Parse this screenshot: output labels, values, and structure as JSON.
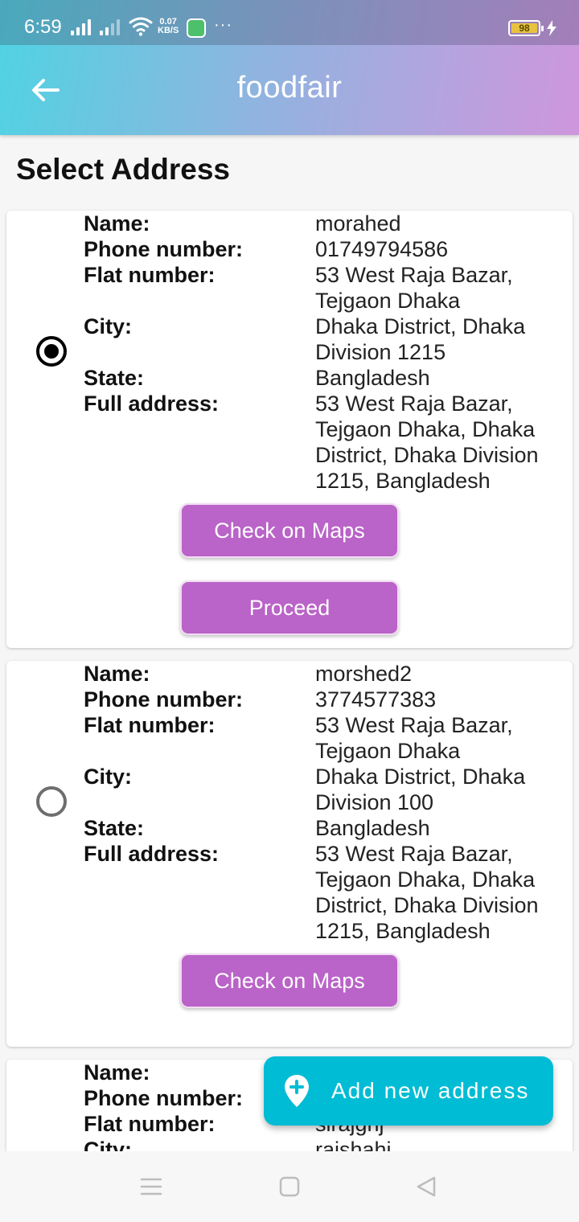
{
  "status_bar": {
    "time": "6:59",
    "net_speed_value": "0.07",
    "net_speed_unit": "KB/S",
    "more": "···",
    "battery": "98"
  },
  "app_bar": {
    "title": "foodfair",
    "back_icon": "arrow-left-icon"
  },
  "page": {
    "heading": "Select Address"
  },
  "labels": {
    "name": "Name:",
    "phone": "Phone number:",
    "flat": "Flat number:",
    "city": "City:",
    "state": "State:",
    "full": "Full address:"
  },
  "addresses": [
    {
      "selected": true,
      "name": "morahed",
      "phone": "01749794586",
      "flat": "53 West Raja Bazar, Tejgaon Dhaka",
      "city": "Dhaka District, Dhaka Division 1215",
      "state": "Bangladesh",
      "full": "53 West Raja Bazar, Tejgaon Dhaka, Dhaka District, Dhaka Division 1215, Bangladesh",
      "maps_label": "Check on Maps",
      "proceed_label": "Proceed"
    },
    {
      "selected": false,
      "name": "morshed2",
      "phone": "3774577383",
      "flat": "53 West Raja Bazar, Tejgaon Dhaka",
      "city": "Dhaka District, Dhaka Division 100",
      "state": "Bangladesh",
      "full": "53 West Raja Bazar, Tejgaon Dhaka, Dhaka District, Dhaka Division 1215, Bangladesh",
      "maps_label": "Check on Maps"
    },
    {
      "selected": false,
      "flat": "sirajgnj",
      "city": "rajshahi"
    }
  ],
  "fab": {
    "label": "Add new address",
    "icon": "add-location-icon"
  },
  "nav_bar": {
    "icons": [
      "menu-icon",
      "home-square-icon",
      "back-triangle-icon"
    ]
  },
  "colors": {
    "gradient_start": "#4fd3e2",
    "gradient_end": "#cf96dd",
    "button": "#ba63c8",
    "fab": "#00bcd4"
  }
}
